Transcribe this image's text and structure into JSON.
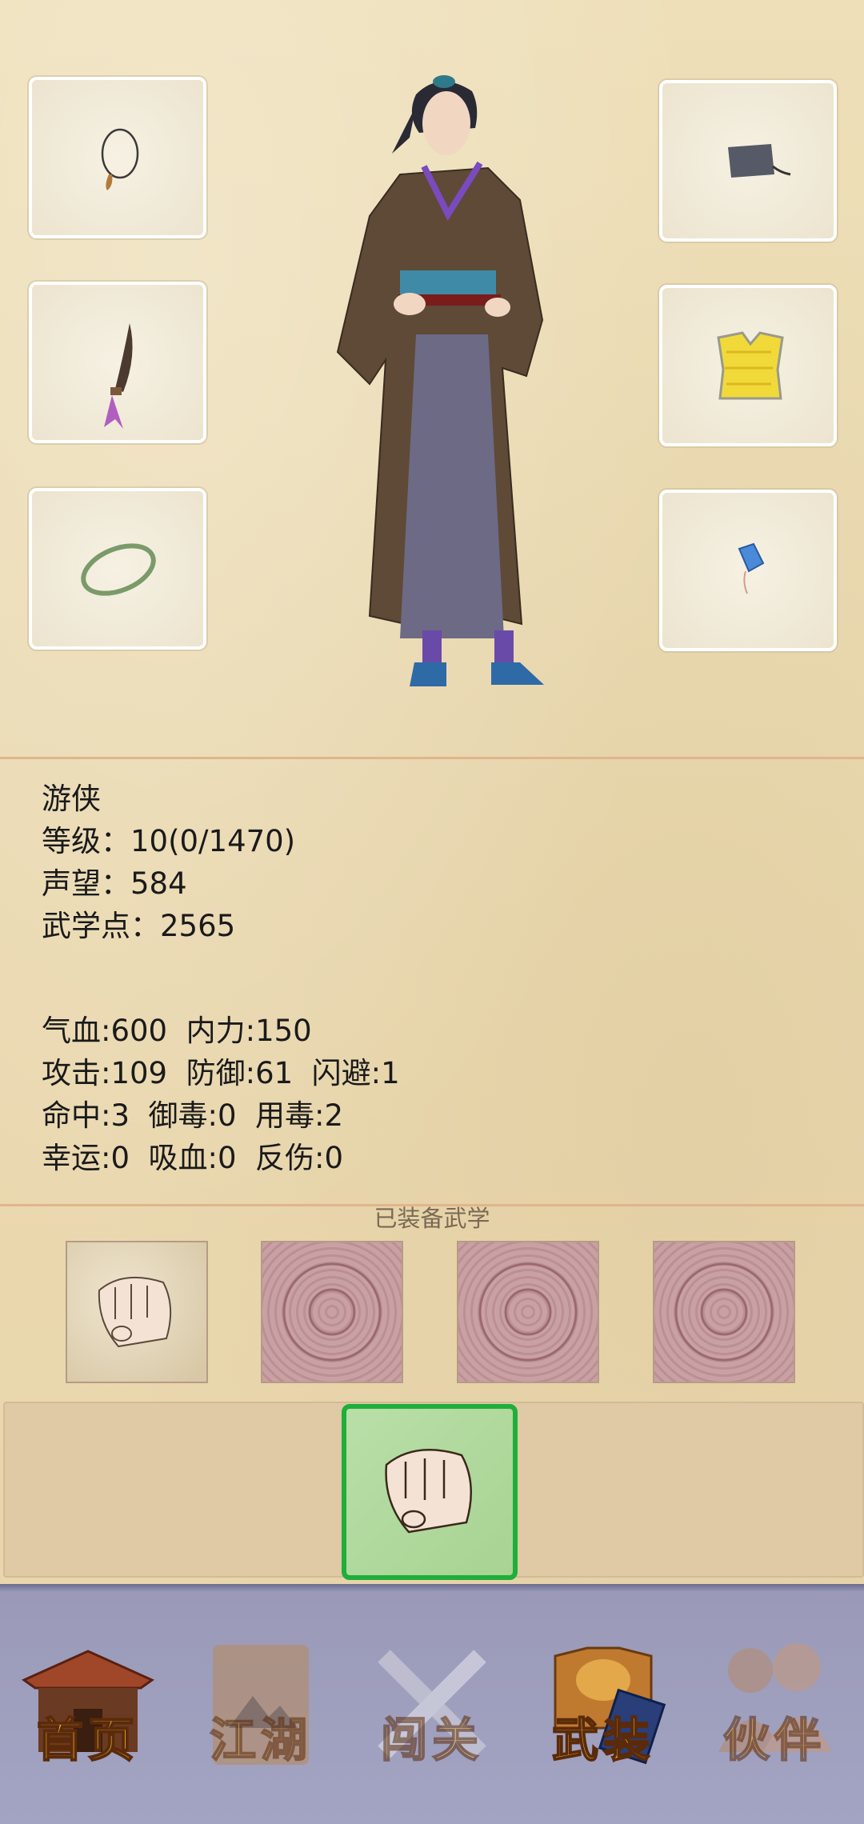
{
  "character": {
    "title": "游侠",
    "level_line": "等级：10(0/1470)",
    "reputation_line": "声望：584",
    "martial_points_line": "武学点：2565"
  },
  "attributes": [
    "气血:600  内力:150",
    "攻击:109  防御:61  闪避:1",
    "命中:3  御毒:0  用毒:2",
    "幸运:0  吸血:0  反伤:0"
  ],
  "equipment_slots": {
    "left": [
      "necklace-icon",
      "weapon-icon",
      "bracelet-icon"
    ],
    "right": [
      "hat-icon",
      "armor-icon",
      "pendant-icon"
    ]
  },
  "skills": {
    "title": "已装备武学",
    "slots": [
      "fist-skill",
      "locked",
      "locked",
      "locked"
    ],
    "selected": "fist-skill"
  },
  "nav": [
    {
      "label": "首页",
      "icon": "house-icon",
      "active": true
    },
    {
      "label": "江湖",
      "icon": "scroll-map-icon",
      "active": false
    },
    {
      "label": "闯关",
      "icon": "crossed-swords-icon",
      "active": false
    },
    {
      "label": "武装",
      "icon": "armor-book-icon",
      "active": true
    },
    {
      "label": "伙伴",
      "icon": "companions-icon",
      "active": false
    }
  ],
  "colors": {
    "selected_border": "#1fae3a",
    "divider": "#e2b48c",
    "nav_text": "#f3c23b"
  }
}
